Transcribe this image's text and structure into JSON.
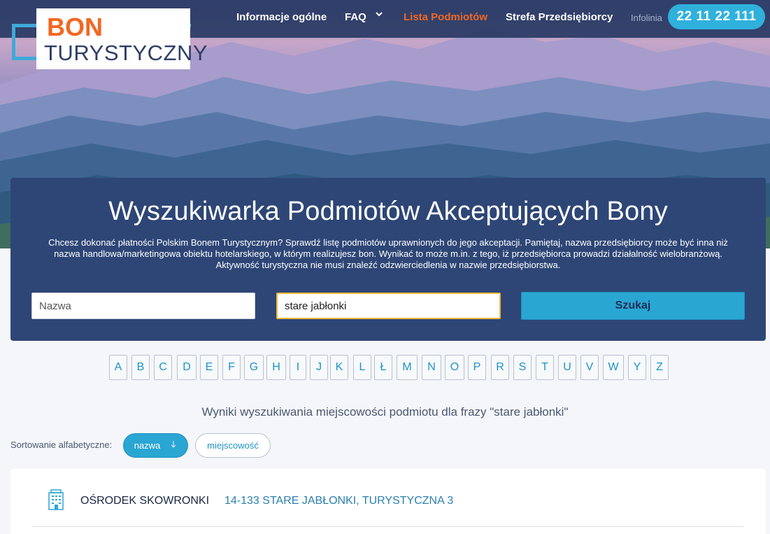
{
  "logo": {
    "line1": "BON",
    "line2": "TURYSTYCZNY"
  },
  "nav": {
    "items": [
      {
        "label": "Informacje ogólne",
        "active": false
      },
      {
        "label": "FAQ",
        "active": false
      },
      {
        "label": "Lista Podmiotów",
        "active": true
      },
      {
        "label": "Strefa Przedsiębiorcy",
        "active": false
      }
    ],
    "infolinia_label": "Infolinia",
    "phone": "22 11 22 111"
  },
  "search": {
    "title": "Wyszukiwarka Podmiotów Akceptujących Bony",
    "description": "Chcesz dokonać płatności Polskim Bonem Turystycznym? Sprawdź listę podmiotów uprawnionych do jego akceptacji. Pamiętaj, nazwa przedsiębiorcy może być inna niż nazwa handlowa/marketingowa obiektu hotelarskiego, w którym realizujesz bon. Wynikać to może m.in. z tego, iż przedsiębiorca prowadzi działalność wielobranżową. Aktywność turystyczna nie musi znaleźć odzwierciedlenia w nazwie przedsiębiorstwa.",
    "name_placeholder": "Nazwa",
    "name_value": "",
    "city_value": "stare jabłonki",
    "button_label": "Szukaj"
  },
  "alphabet": [
    "A",
    "B",
    "C",
    "D",
    "E",
    "F",
    "G",
    "H",
    "I",
    "J",
    "K",
    "L",
    "Ł",
    "M",
    "N",
    "O",
    "P",
    "R",
    "S",
    "T",
    "U",
    "V",
    "W",
    "Y",
    "Z"
  ],
  "results": {
    "caption": "Wyniki wyszukiwania miejscowości podmiotu dla frazy \"stare jabłonki\"",
    "sort_label": "Sortowanie alfabetyczne:",
    "sort_name": "nazwa",
    "sort_city": "miejscowość",
    "items": [
      {
        "name": "OŚRODEK SKOWRONKI",
        "address": "14-133 STARE JABŁONKI, TURYSTYCZNA 3",
        "icon": "building-icon"
      }
    ]
  },
  "colors": {
    "accent": "#2aa6d3",
    "brand_orange": "#f26722",
    "panel": "#2e4676"
  }
}
